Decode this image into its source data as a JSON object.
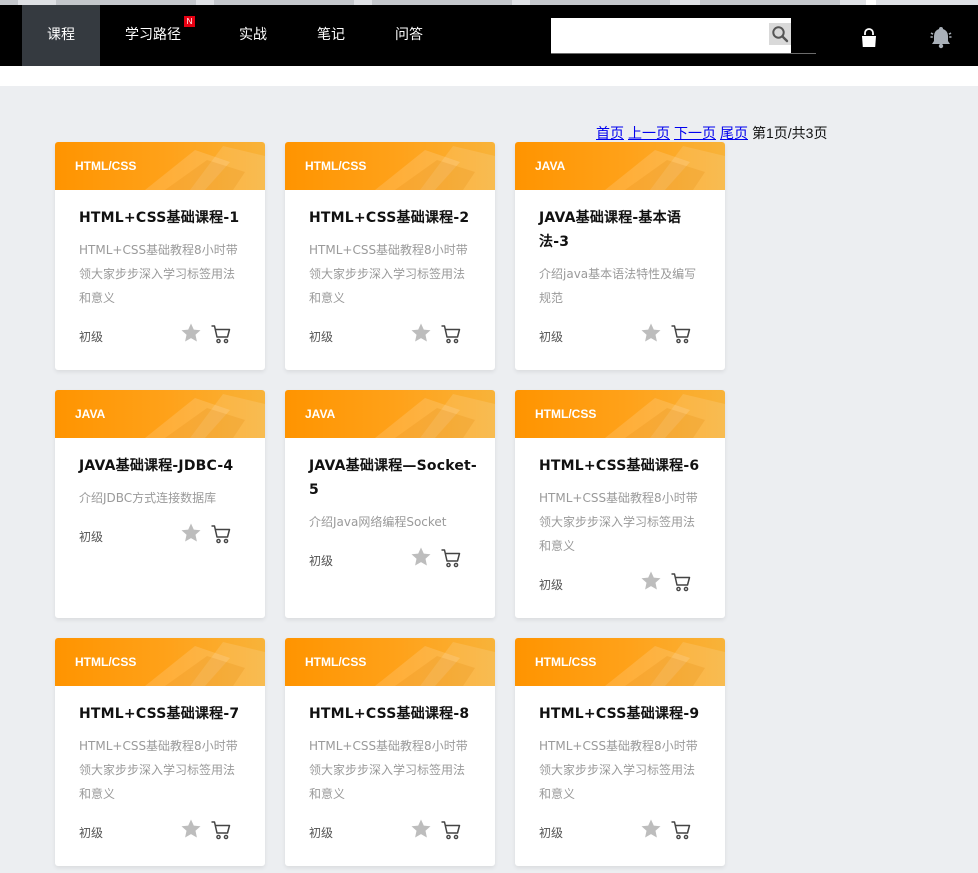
{
  "nav": {
    "items": [
      {
        "label": "课程",
        "active": true
      },
      {
        "label": "学习路径",
        "badge": "N"
      },
      {
        "label": "实战"
      },
      {
        "label": "笔记"
      },
      {
        "label": "问答"
      }
    ],
    "search": {
      "value": "",
      "placeholder": ""
    },
    "icons": [
      "search-icon",
      "bag-icon",
      "bell-icon"
    ]
  },
  "pager": {
    "first": "首页",
    "prev": "上一页",
    "next": "下一页",
    "last": "尾页",
    "status": "第1页/共3页"
  },
  "colors": {
    "accent": "#ff9400",
    "navbar": "#000000",
    "nav_active": "#353a40",
    "badge": "#e60012",
    "page_bg": "#eceef1"
  },
  "courses": [
    {
      "tag": "HTML/CSS",
      "title": "HTML+CSS基础课程-1",
      "desc": "HTML+CSS基础教程8小时带领大家步步深入学习标签用法和意义",
      "level": "初级"
    },
    {
      "tag": "HTML/CSS",
      "title": "HTML+CSS基础课程-2",
      "desc": "HTML+CSS基础教程8小时带领大家步步深入学习标签用法和意义",
      "level": "初级"
    },
    {
      "tag": "JAVA",
      "title": "JAVA基础课程-基本语法-3",
      "desc": "介绍java基本语法特性及编写规范",
      "level": "初级"
    },
    {
      "tag": "JAVA",
      "title": "JAVA基础课程-JDBC-4",
      "desc": "介绍JDBC方式连接数据库",
      "level": "初级"
    },
    {
      "tag": "JAVA",
      "title": "JAVA基础课程—Socket-5",
      "desc": "介绍Java网络编程Socket",
      "level": "初级"
    },
    {
      "tag": "HTML/CSS",
      "title": "HTML+CSS基础课程-6",
      "desc": "HTML+CSS基础教程8小时带领大家步步深入学习标签用法和意义",
      "level": "初级"
    },
    {
      "tag": "HTML/CSS",
      "title": "HTML+CSS基础课程-7",
      "desc": "HTML+CSS基础教程8小时带领大家步步深入学习标签用法和意义",
      "level": "初级"
    },
    {
      "tag": "HTML/CSS",
      "title": "HTML+CSS基础课程-8",
      "desc": "HTML+CSS基础教程8小时带领大家步步深入学习标签用法和意义",
      "level": "初级"
    },
    {
      "tag": "HTML/CSS",
      "title": "HTML+CSS基础课程-9",
      "desc": "HTML+CSS基础教程8小时带领大家步步深入学习标签用法和意义",
      "level": "初级"
    }
  ]
}
